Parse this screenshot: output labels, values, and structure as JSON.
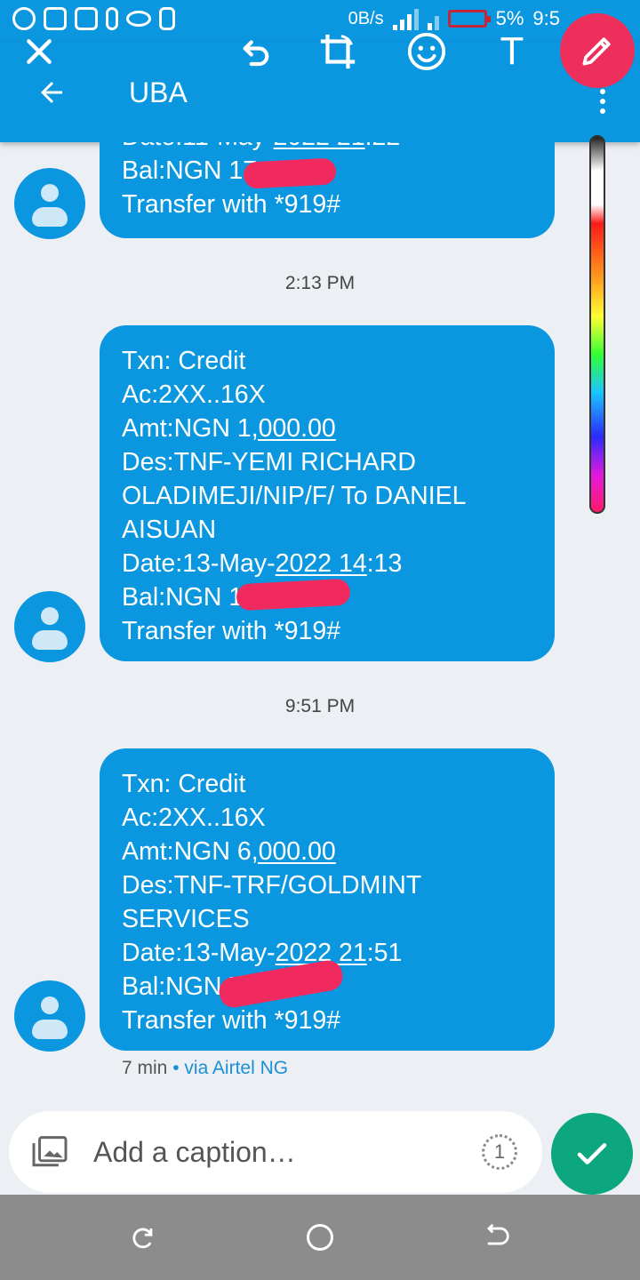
{
  "status_bar": {
    "net_speed": "0B/s",
    "battery_percent": "5%",
    "time": "9:5",
    "colors": {
      "background": "#0a97e0",
      "battery_low": "#c0283a"
    }
  },
  "toolbar": {
    "close_icon": "close-icon",
    "undo_icon": "undo-icon",
    "crop_icon": "crop-rotate-icon",
    "emoji_icon": "emoji-icon",
    "text_tool_label": "T",
    "pencil_icon": "pencil-icon",
    "pencil_color": "#ee2f5c"
  },
  "app_bar": {
    "title": "UBA",
    "back_icon": "arrow-back-icon",
    "menu_icon": "more-vert-icon"
  },
  "messages": [
    {
      "lines": [
        "Date:11-May-2022 21:22",
        "Bal:NGN 17",
        "Transfer with *919#"
      ],
      "partial": true
    },
    {
      "time_separator": "2:13 PM",
      "lines": [
        "Txn: Credit",
        "Ac:2XX..16X",
        "Amt:NGN 1,000.00",
        "Des:TNF-YEMI RICHARD",
        "OLADIMEJI/NIP/F/ To DANIEL",
        "AISUAN",
        "Date:13-May-2022 14:13",
        "Bal:NGN 1",
        "Transfer with *919#"
      ]
    },
    {
      "time_separator": "9:51 PM",
      "lines": [
        "Txn: Credit",
        "Ac:2XX..16X",
        "Amt:NGN 6,000.00",
        "Des:TNF-TRF/GOLDMINT",
        "SERVICES",
        "Date:13-May-2022 21:51",
        "Bal:NGN 7",
        "Transfer with *919#"
      ],
      "meta_time": "7 min",
      "meta_sep": "•",
      "meta_via": "via Airtel NG"
    }
  ],
  "caption": {
    "placeholder": "Add a caption…",
    "view_once_label": "1",
    "gallery_icon": "gallery-icon"
  },
  "send_button": {
    "icon": "check-icon",
    "color": "#0ca77f"
  },
  "nav_bar": {
    "recents_icon": "recents-icon",
    "home_icon": "home-icon",
    "back_icon": "nav-back-icon"
  }
}
